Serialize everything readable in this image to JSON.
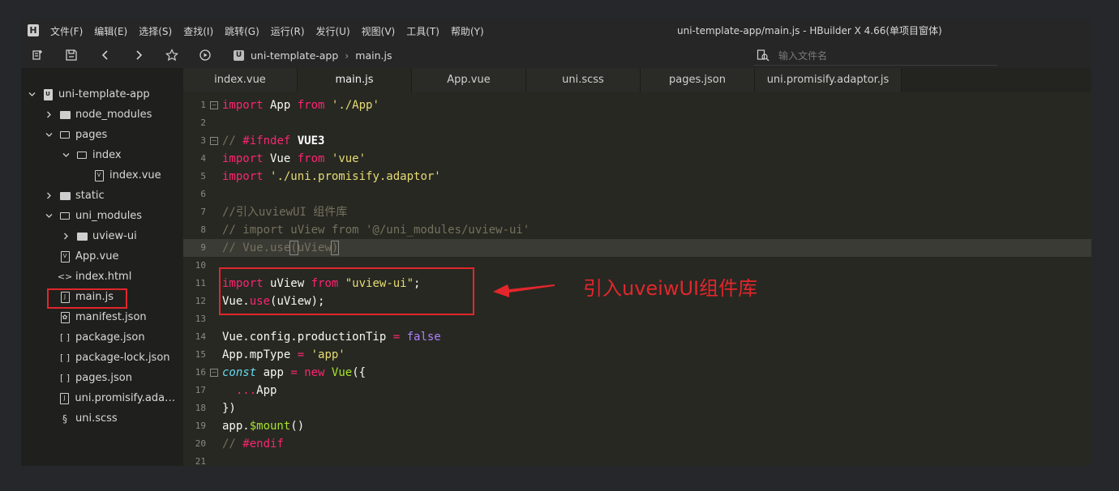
{
  "menubar": {
    "logo": "H",
    "items": [
      "文件(F)",
      "编辑(E)",
      "选择(S)",
      "查找(I)",
      "跳转(G)",
      "运行(R)",
      "发行(U)",
      "视图(V)",
      "工具(T)",
      "帮助(Y)"
    ],
    "title": "uni-template-app/main.js - HBuilder X 4.66(单项目窗体)"
  },
  "toolbar": {
    "breadcrumb_badge": "U",
    "breadcrumb_project": "uni-template-app",
    "breadcrumb_sep": "›",
    "breadcrumb_file": "main.js",
    "search_placeholder": "输入文件名"
  },
  "sidebar": {
    "items": [
      {
        "label": "uni-template-app"
      },
      {
        "label": "node_modules"
      },
      {
        "label": "pages"
      },
      {
        "label": "index"
      },
      {
        "label": "index.vue"
      },
      {
        "label": "static"
      },
      {
        "label": "uni_modules"
      },
      {
        "label": "uview-ui"
      },
      {
        "label": "App.vue"
      },
      {
        "label": "index.html"
      },
      {
        "label": "main.js"
      },
      {
        "label": "manifest.json"
      },
      {
        "label": "package.json"
      },
      {
        "label": "package-lock.json"
      },
      {
        "label": "pages.json"
      },
      {
        "label": "uni.promisify.adapt..."
      },
      {
        "label": "uni.scss"
      }
    ]
  },
  "tabs": [
    "index.vue",
    "main.js",
    "App.vue",
    "uni.scss",
    "pages.json",
    "uni.promisify.adaptor.js"
  ],
  "active_tab": "main.js",
  "editor": {
    "line_numbers": [
      "1",
      "2",
      "3",
      "4",
      "5",
      "6",
      "7",
      "8",
      "9",
      "10",
      "11",
      "12",
      "13",
      "14",
      "15",
      "16",
      "17",
      "18",
      "19",
      "20",
      "21"
    ]
  },
  "annotation": {
    "text": "引入uveiwUI组件库",
    "color": "#e2262c"
  },
  "colors": {
    "background": "#272822",
    "sidebar": "#1f201d",
    "keyword": "#f92672",
    "string": "#e6db74",
    "comment": "#75715e",
    "annotation_red": "#e2262c"
  }
}
